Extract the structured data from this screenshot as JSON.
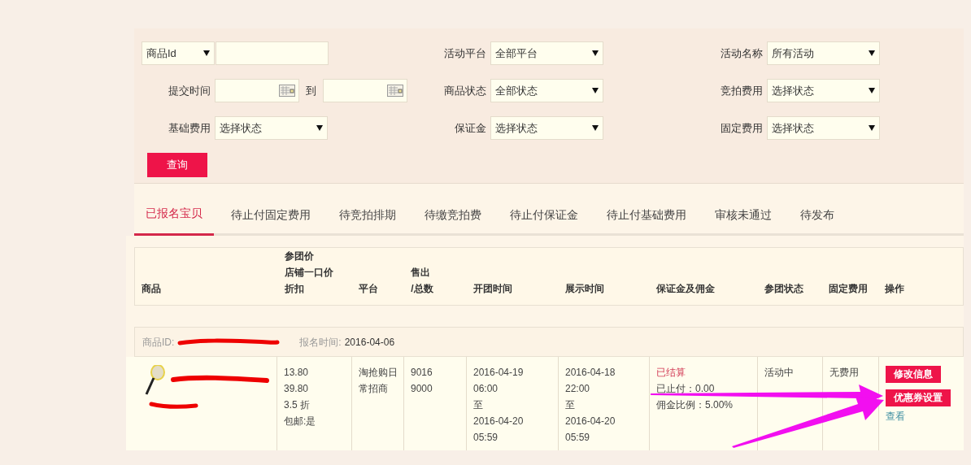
{
  "filters": [
    {
      "kind": "key_select",
      "value": "商品Id"
    },
    {
      "kind": "select",
      "label": "活动平台",
      "value": "全部平台"
    },
    {
      "kind": "select",
      "label": "活动名称",
      "value": "所有活动"
    },
    {
      "kind": "date_range",
      "label": "提交时间",
      "separator": "到"
    },
    {
      "kind": "select",
      "label": "商品状态",
      "value": "全部状态"
    },
    {
      "kind": "select",
      "label": "竞拍费用",
      "value": "选择状态"
    },
    {
      "kind": "select",
      "label": "基础费用",
      "value": "选择状态"
    },
    {
      "kind": "select",
      "label": "保证金",
      "value": "选择状态"
    },
    {
      "kind": "select",
      "label": "固定费用",
      "value": "选择状态"
    }
  ],
  "search_button": "查询",
  "tabs": [
    {
      "label": "已报名宝贝",
      "selected": true
    },
    {
      "label": "待止付固定费用",
      "selected": false
    },
    {
      "label": "待竞拍排期",
      "selected": false
    },
    {
      "label": "待缴竞拍费",
      "selected": false
    },
    {
      "label": "待止付保证金",
      "selected": false
    },
    {
      "label": "待止付基础费用",
      "selected": false
    },
    {
      "label": "审核未通过",
      "selected": false
    },
    {
      "label": "待发布",
      "selected": false
    }
  ],
  "table": {
    "columns": [
      [
        "商品"
      ],
      [
        "参团价",
        "店铺一口价",
        "折扣"
      ],
      [
        "平台"
      ],
      [
        "售出",
        "/总数"
      ],
      [
        "开团时间"
      ],
      [
        "展示时间"
      ],
      [
        "保证金及佣金"
      ],
      [
        "参团状态"
      ],
      [
        "固定费用"
      ],
      [
        "操作"
      ]
    ],
    "rows": [
      {
        "id_label": "商品ID:",
        "date_label": "报名时间:",
        "date": "2016-04-06",
        "price": [
          "13.80",
          "39.80",
          "3.5 折",
          "包邮:是"
        ],
        "platform": "淘抢购日常招商",
        "sold": [
          "9016",
          "9000"
        ],
        "open_time": [
          "2016-04-19",
          "06:00",
          "至",
          "2016-04-20",
          "05:59"
        ],
        "show_time": [
          "2016-04-18",
          "22:00",
          "至",
          "2016-04-20",
          "05:59"
        ],
        "deposit": [
          {
            "kind": "status",
            "text": "已结算"
          },
          {
            "kind": "plain",
            "text": "已止付：0.00"
          },
          {
            "kind": "plain",
            "text": "佣金比例：5.00%"
          }
        ],
        "status": "活动中",
        "fixed_fee": "无费用",
        "actions": [
          {
            "kind": "button",
            "label": "修改信息"
          },
          {
            "kind": "button",
            "label": "优惠券设置"
          },
          {
            "kind": "link",
            "label": "查看"
          }
        ]
      }
    ]
  }
}
